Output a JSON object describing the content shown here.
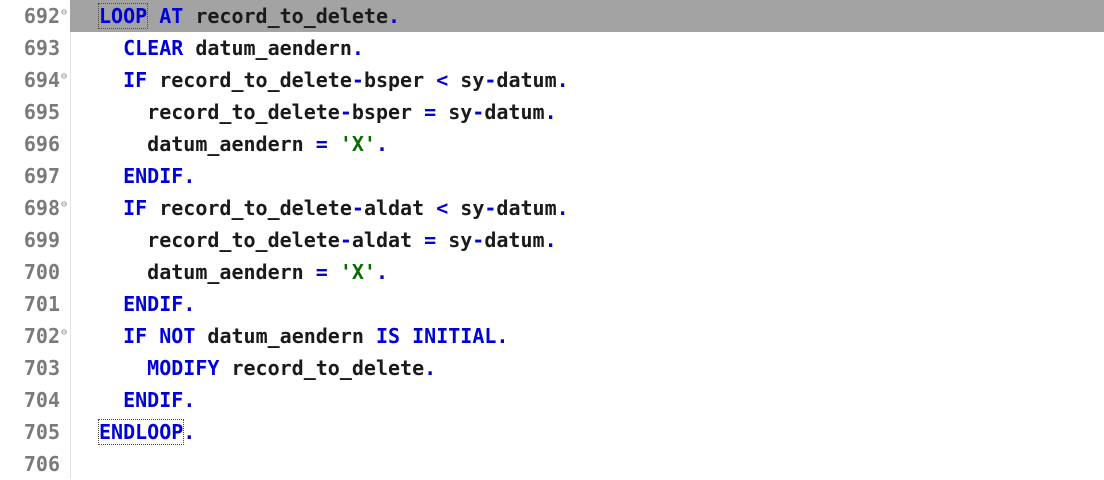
{
  "editor": {
    "current_line": "692",
    "lines": [
      {
        "number": "692",
        "foldable": true,
        "indent": "",
        "tokens": [
          {
            "t": "LOOP",
            "c": "kw",
            "match": true
          },
          {
            "t": " ",
            "c": "id"
          },
          {
            "t": "AT",
            "c": "kw"
          },
          {
            "t": " record_to_delete",
            "c": "id"
          },
          {
            "t": ".",
            "c": "op"
          }
        ]
      },
      {
        "number": "693",
        "foldable": false,
        "indent": "  ",
        "tokens": [
          {
            "t": "CLEAR",
            "c": "kw"
          },
          {
            "t": " datum_aendern",
            "c": "id"
          },
          {
            "t": ".",
            "c": "op"
          }
        ]
      },
      {
        "number": "694",
        "foldable": true,
        "indent": "  ",
        "tokens": [
          {
            "t": "IF",
            "c": "kw"
          },
          {
            "t": " record_to_delete",
            "c": "id"
          },
          {
            "t": "-",
            "c": "op"
          },
          {
            "t": "bsper ",
            "c": "id"
          },
          {
            "t": "<",
            "c": "op"
          },
          {
            "t": " sy",
            "c": "id"
          },
          {
            "t": "-",
            "c": "op"
          },
          {
            "t": "datum",
            "c": "id"
          },
          {
            "t": ".",
            "c": "op"
          }
        ]
      },
      {
        "number": "695",
        "foldable": false,
        "indent": "    ",
        "tokens": [
          {
            "t": "record_to_delete",
            "c": "id"
          },
          {
            "t": "-",
            "c": "op"
          },
          {
            "t": "bsper ",
            "c": "id"
          },
          {
            "t": "=",
            "c": "op"
          },
          {
            "t": " sy",
            "c": "id"
          },
          {
            "t": "-",
            "c": "op"
          },
          {
            "t": "datum",
            "c": "id"
          },
          {
            "t": ".",
            "c": "op"
          }
        ]
      },
      {
        "number": "696",
        "foldable": false,
        "indent": "    ",
        "tokens": [
          {
            "t": "datum_aendern ",
            "c": "id"
          },
          {
            "t": "=",
            "c": "op"
          },
          {
            "t": " ",
            "c": "id"
          },
          {
            "t": "'X'",
            "c": "str"
          },
          {
            "t": ".",
            "c": "op"
          }
        ]
      },
      {
        "number": "697",
        "foldable": false,
        "indent": "  ",
        "tokens": [
          {
            "t": "ENDIF",
            "c": "kw"
          },
          {
            "t": ".",
            "c": "op"
          }
        ]
      },
      {
        "number": "698",
        "foldable": true,
        "indent": "  ",
        "tokens": [
          {
            "t": "IF",
            "c": "kw"
          },
          {
            "t": " record_to_delete",
            "c": "id"
          },
          {
            "t": "-",
            "c": "op"
          },
          {
            "t": "aldat ",
            "c": "id"
          },
          {
            "t": "<",
            "c": "op"
          },
          {
            "t": " sy",
            "c": "id"
          },
          {
            "t": "-",
            "c": "op"
          },
          {
            "t": "datum",
            "c": "id"
          },
          {
            "t": ".",
            "c": "op"
          }
        ]
      },
      {
        "number": "699",
        "foldable": false,
        "indent": "    ",
        "tokens": [
          {
            "t": "record_to_delete",
            "c": "id"
          },
          {
            "t": "-",
            "c": "op"
          },
          {
            "t": "aldat ",
            "c": "id"
          },
          {
            "t": "=",
            "c": "op"
          },
          {
            "t": " sy",
            "c": "id"
          },
          {
            "t": "-",
            "c": "op"
          },
          {
            "t": "datum",
            "c": "id"
          },
          {
            "t": ".",
            "c": "op"
          }
        ]
      },
      {
        "number": "700",
        "foldable": false,
        "indent": "    ",
        "tokens": [
          {
            "t": "datum_aendern ",
            "c": "id"
          },
          {
            "t": "=",
            "c": "op"
          },
          {
            "t": " ",
            "c": "id"
          },
          {
            "t": "'X'",
            "c": "str"
          },
          {
            "t": ".",
            "c": "op"
          }
        ]
      },
      {
        "number": "701",
        "foldable": false,
        "indent": "  ",
        "tokens": [
          {
            "t": "ENDIF",
            "c": "kw"
          },
          {
            "t": ".",
            "c": "op"
          }
        ]
      },
      {
        "number": "702",
        "foldable": true,
        "indent": "  ",
        "tokens": [
          {
            "t": "IF",
            "c": "kw"
          },
          {
            "t": " ",
            "c": "id"
          },
          {
            "t": "NOT",
            "c": "kw"
          },
          {
            "t": " datum_aendern ",
            "c": "id"
          },
          {
            "t": "IS",
            "c": "kw"
          },
          {
            "t": " ",
            "c": "id"
          },
          {
            "t": "INITIAL",
            "c": "kw"
          },
          {
            "t": ".",
            "c": "op"
          }
        ]
      },
      {
        "number": "703",
        "foldable": false,
        "indent": "    ",
        "tokens": [
          {
            "t": "MODIFY",
            "c": "kw"
          },
          {
            "t": " record_to_delete",
            "c": "id"
          },
          {
            "t": ".",
            "c": "op"
          }
        ]
      },
      {
        "number": "704",
        "foldable": false,
        "indent": "  ",
        "tokens": [
          {
            "t": "ENDIF",
            "c": "kw"
          },
          {
            "t": ".",
            "c": "op"
          }
        ]
      },
      {
        "number": "705",
        "foldable": false,
        "indent": "",
        "tokens": [
          {
            "t": "ENDLOOP",
            "c": "kw",
            "match": true
          },
          {
            "t": ".",
            "c": "op"
          }
        ]
      },
      {
        "number": "706",
        "foldable": false,
        "indent": "",
        "tokens": []
      }
    ],
    "fold_glyph": "⊖",
    "colors": {
      "keyword": "#0000d8",
      "identifier": "#1a1a1a",
      "string": "#0a6b00",
      "line_number": "#7b7b7b",
      "current_line_highlight": "#a3a3a3"
    }
  }
}
